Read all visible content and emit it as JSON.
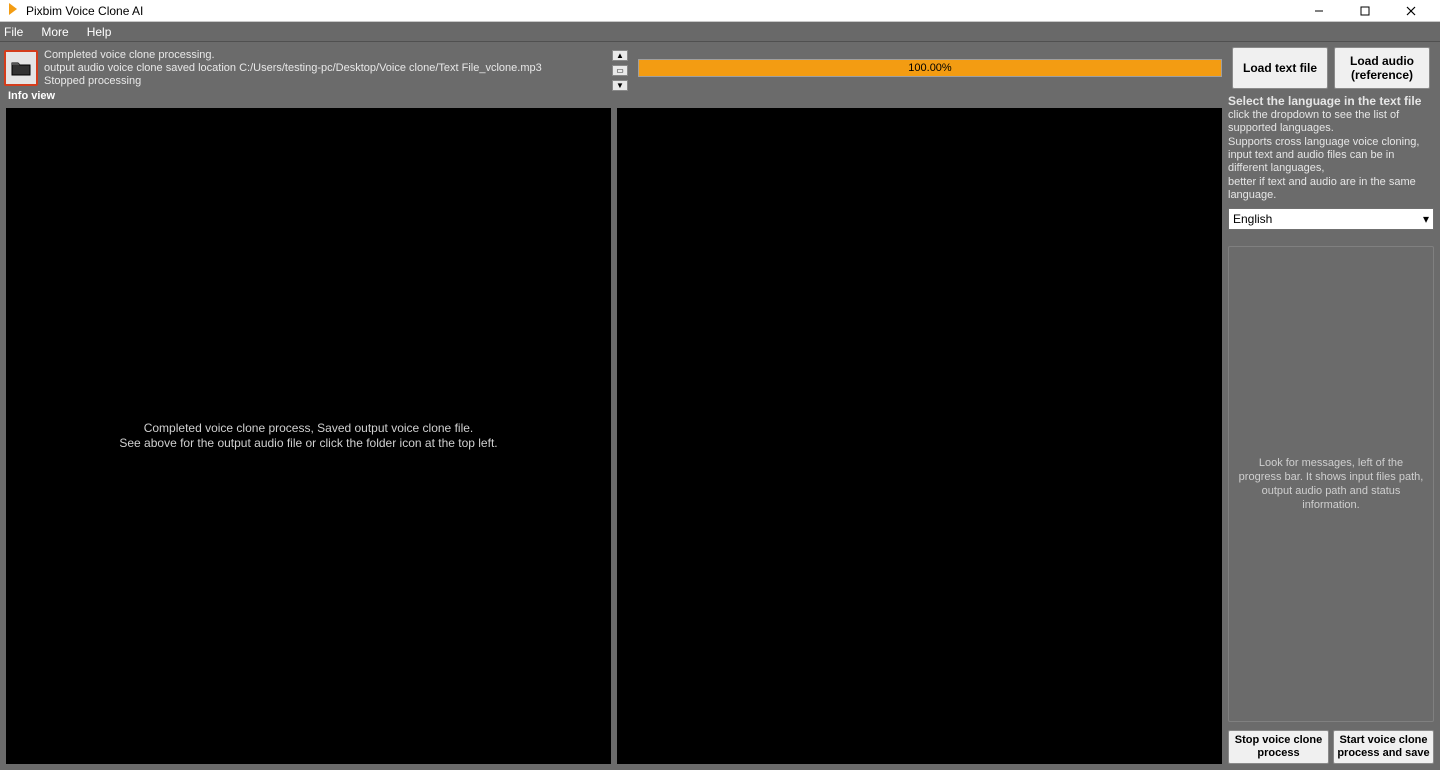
{
  "titlebar": {
    "title": "Pixbim Voice Clone AI"
  },
  "menu": {
    "file": "File",
    "more": "More",
    "help": "Help"
  },
  "log": {
    "line1": "Completed voice clone processing.",
    "line2": "output audio voice clone saved location C:/Users/testing-pc/Desktop/Voice clone/Text File_vclone.mp3",
    "line3": "Stopped processing"
  },
  "progress": {
    "percent_label": "100.00%",
    "percent_value": 100
  },
  "buttons": {
    "load_text": "Load text file",
    "load_audio": "Load audio (reference)",
    "stop": "Stop voice clone process",
    "start": "Start voice clone process and save"
  },
  "info_view_label": "Info view",
  "left_panel": {
    "line1": "Completed voice clone process, Saved output voice clone file.",
    "line2": "See above for the output audio file or click the folder icon at the top left."
  },
  "side": {
    "heading": "Select the language in the text file",
    "note1": "click the dropdown to see the list of supported languages.",
    "note2": "Supports cross language voice cloning, input text and audio files can be in different languages,",
    "note3": "better if text and audio are in the same language.",
    "language": "English",
    "msgbox": "Look for messages, left of the progress bar. It shows input files path, output audio path and status information."
  }
}
